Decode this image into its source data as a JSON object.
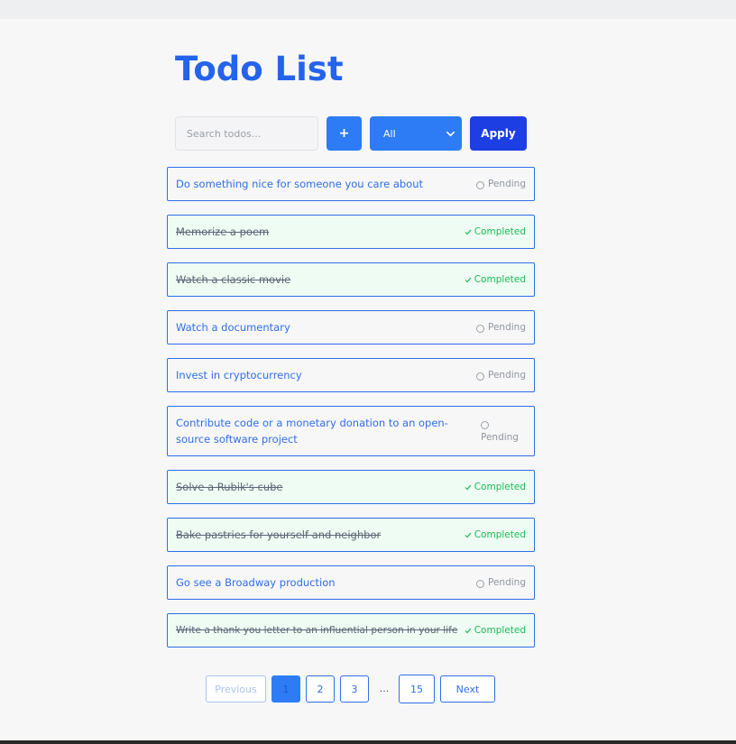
{
  "header": {
    "title": "Todo List"
  },
  "toolbar": {
    "search_placeholder": "Search todos...",
    "add_label": "+",
    "filter_value": "All",
    "apply_label": "Apply"
  },
  "todos": [
    {
      "text": "Do something nice for someone you care about",
      "status": "Pending",
      "completed": false
    },
    {
      "text": "Memorize a poem",
      "status": "Completed",
      "completed": true
    },
    {
      "text": "Watch a classic movie",
      "status": "Completed",
      "completed": true
    },
    {
      "text": "Watch a documentary",
      "status": "Pending",
      "completed": false
    },
    {
      "text": "Invest in cryptocurrency",
      "status": "Pending",
      "completed": false
    },
    {
      "text": "Contribute code or a monetary donation to an open-source software project",
      "status": "Pending",
      "completed": false
    },
    {
      "text": "Solve a Rubik's cube",
      "status": "Completed",
      "completed": true
    },
    {
      "text": "Bake pastries for yourself and neighbor",
      "status": "Completed",
      "completed": true
    },
    {
      "text": "Go see a Broadway production",
      "status": "Pending",
      "completed": false
    },
    {
      "text": "Write a thank you letter to an influential person in your life",
      "status": "Completed",
      "completed": true
    }
  ],
  "pagination": {
    "previous_label": "Previous",
    "pages": [
      "1",
      "2",
      "3"
    ],
    "ellipsis": "...",
    "last_page": "15",
    "next_label": "Next",
    "current_page": "1"
  },
  "colors": {
    "accent": "#2d7cf6",
    "title": "#2463eb",
    "apply": "#1c3ee3",
    "completed_text": "#1fb85a",
    "pending_text": "#8f96a0",
    "completed_bg": "#eefcf3"
  }
}
